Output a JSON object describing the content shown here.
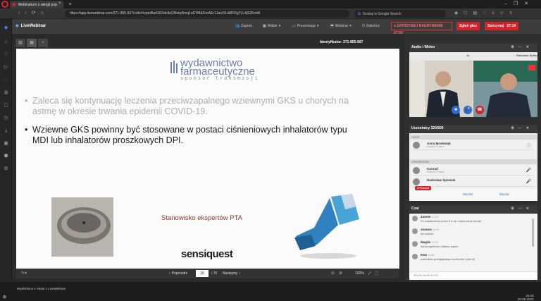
{
  "browser": {
    "tab_title": "Webinarium o alergii pop",
    "tab_close": "×",
    "new_tab": "+",
    "window_controls": [
      "–",
      "❐",
      "✕"
    ],
    "nav_buttons": [
      "‹",
      "›",
      "⟳",
      "⌂"
    ],
    "url": "https://app.livewebinar.com/371-855-667/c/dsVrcptoBarGKXdc9eDl9oky5mq1oEYMdZooAEr1Jan/XLld8FRg7LL4jS2KmW",
    "search_placeholder": "Szukaj w Google Search"
  },
  "app": {
    "logo": "LiveWebinar",
    "menu": [
      {
        "icon": "people-icon",
        "label": "Zaproś"
      },
      {
        "icon": "view-icon",
        "label": "Widok"
      },
      {
        "icon": "presentation-icon",
        "label": "Prezentacje"
      },
      {
        "icon": "webinar-icon",
        "label": "Webinar"
      },
      {
        "icon": "close-webinar-icon",
        "label": "Zakończ"
      }
    ],
    "recording": "● ZATRZYMAJ NAGRYWANIE 27:03",
    "raise_hand": "Zgłoś głos",
    "stop_btn": "Zatrzymaj",
    "stop_time": "27:14",
    "clock": "2:14"
  },
  "presentation": {
    "identifier": "Identyfikator: 371-855-667",
    "publisher_name_1": "wydawnictwo",
    "publisher_name_2": "farmaceutyczne",
    "publisher_sub": "sponsor transmisji",
    "bullet_1": "Zaleca się kontynuację leczenia przeciwzapalnego wziewnymi GKS u chorych na astmę w okresie trwania epidemii COVID-19.",
    "bullet_2": "Wziewne GKS powinny być stosowane w postaci ciśnieniowych inhalatorów typu MDI lub inhalatorów proszkowych DPI.",
    "caption": "Stanowisko ekspertów PTA",
    "sponsor_logo": "sensiquest",
    "pager": {
      "prev": "Poprzedni",
      "page": "16",
      "total": "/ 70",
      "next": "Następny",
      "zoom": "100%"
    }
  },
  "av_panel": {
    "title": "Audio i Wideo",
    "speaker_1": "Ja",
    "speaker_2": "Radosław Śpiewak"
  },
  "users_panel": {
    "title": "Uczestnicy 320/500",
    "group_host": "HOST",
    "group_presenter": "PREZENTER",
    "users": [
      {
        "name": "Anna Moskwiak",
        "sub": "Kraków, Poland"
      },
      {
        "name": "Konrad",
        "sub": "Kraków, Poland"
      },
      {
        "name": "Radosław Śpiewak",
        "sub": ""
      }
    ],
    "badge": "SPRAWDŹ",
    "mic_all_off": "Wycisz",
    "mic_all_on": "Wycisz"
  },
  "chat_panel": {
    "title": "Czat",
    "messages": [
      {
        "name": "Zanete",
        "time": "12:03",
        "text": "Po odświeżeniu przez 5 s ok i znów same kreski"
      },
      {
        "name": "Joanna",
        "time": "12:03",
        "text": "No dobrze"
      },
      {
        "name": "Magda",
        "time": "12:03",
        "text": "Na komputerze odbiera super!"
      },
      {
        "name": "Ewa",
        "time": "12:05",
        "text": "zmieniłam przeglądarkę na chrome i jest ok"
      }
    ],
    "input_placeholder": "Wyślij wiadomość..."
  },
  "taskbar": {
    "share_text": "Wydzielono 1 ekran z LiveWebinar",
    "time": "20:03",
    "date": "20.05.2020"
  }
}
